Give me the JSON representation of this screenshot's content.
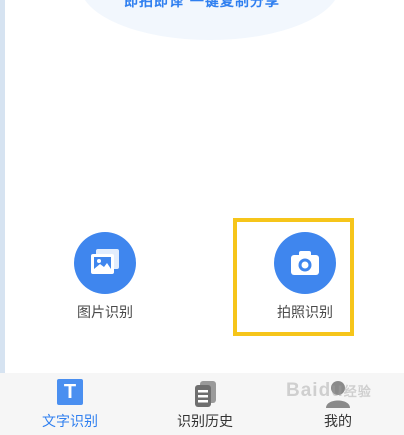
{
  "banner": {
    "text": "即拍即译 一键复制分享"
  },
  "features": {
    "gallery": {
      "label": "图片识别",
      "icon": "image-gallery-icon"
    },
    "camera": {
      "label": "拍照识别",
      "icon": "camera-icon"
    }
  },
  "tabs": [
    {
      "label": "文字识别",
      "icon": "text-t-icon",
      "active": true
    },
    {
      "label": "识别历史",
      "icon": "history-stack-icon",
      "active": false
    },
    {
      "label": "我的",
      "icon": "user-icon",
      "active": false
    }
  ],
  "watermark": {
    "text": "Baidu",
    "suffix": "经验"
  },
  "colors": {
    "accent": "#3f86ee",
    "highlight": "#f6c51a",
    "tab_active": "#2f7ff0"
  }
}
